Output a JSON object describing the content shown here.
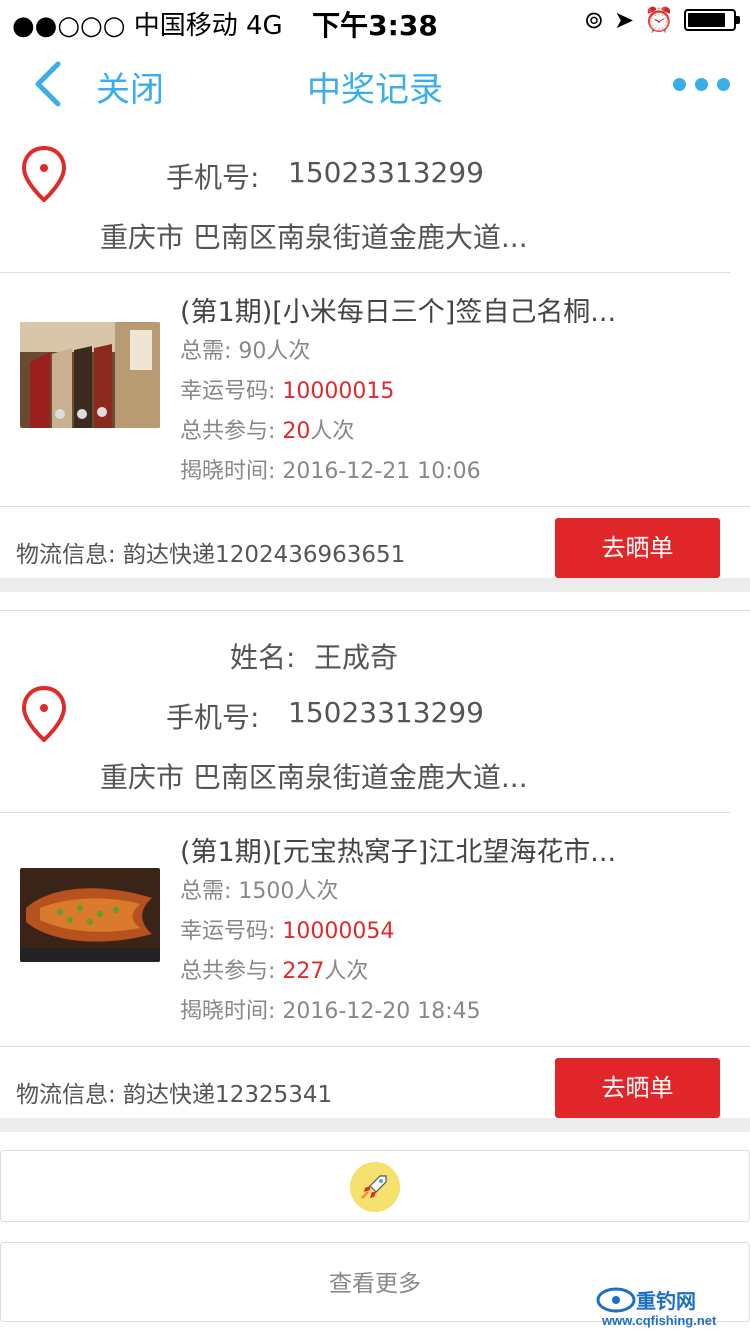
{
  "status_bar": {
    "carrier": "●●○○○ 中国移动   4G",
    "time": "下午3:38",
    "battery_level": 0.85
  },
  "nav": {
    "back_label": "关闭",
    "title": "中奖记录"
  },
  "records": [
    {
      "address": {
        "name_label": "",
        "name_value": "",
        "phone_label": "手机号:",
        "phone_value": "15023313299",
        "address": "重庆市 巴南区南泉街道金鹿大道..."
      },
      "item": {
        "title": "(第1期)[小米每日三个]签自己名桐...",
        "total_label": "总需:",
        "total_value": "90人次",
        "lucky_label": "幸运号码:",
        "lucky_value": "10000015",
        "join_label": "总共参与:",
        "join_count": "20",
        "join_unit": "人次",
        "time_label": "揭晓时间:",
        "time_value": "2016-12-21 10:06"
      },
      "logistics": "物流信息:  韵达快递1202436963651",
      "button": "去晒单"
    },
    {
      "address": {
        "name_label": "姓名:",
        "name_value": "王成奇",
        "phone_label": "手机号:",
        "phone_value": "15023313299",
        "address": "重庆市 巴南区南泉街道金鹿大道..."
      },
      "item": {
        "title": "(第1期)[元宝热窝子]江北望海花市...",
        "total_label": "总需:",
        "total_value": "1500人次",
        "lucky_label": "幸运号码:",
        "lucky_value": "10000054",
        "join_label": "总共参与:",
        "join_count": "227",
        "join_unit": "人次",
        "time_label": "揭晓时间:",
        "time_value": "2016-12-20 18:45"
      },
      "logistics": "物流信息:  韵达快递12325341",
      "button": "去晒单"
    }
  ],
  "load_more": "查看更多",
  "watermark": "重钓网 www.cqfishing.net",
  "colors": {
    "accent": "#3aaee8",
    "red": "#e02a2a",
    "button": "#e1262a"
  }
}
